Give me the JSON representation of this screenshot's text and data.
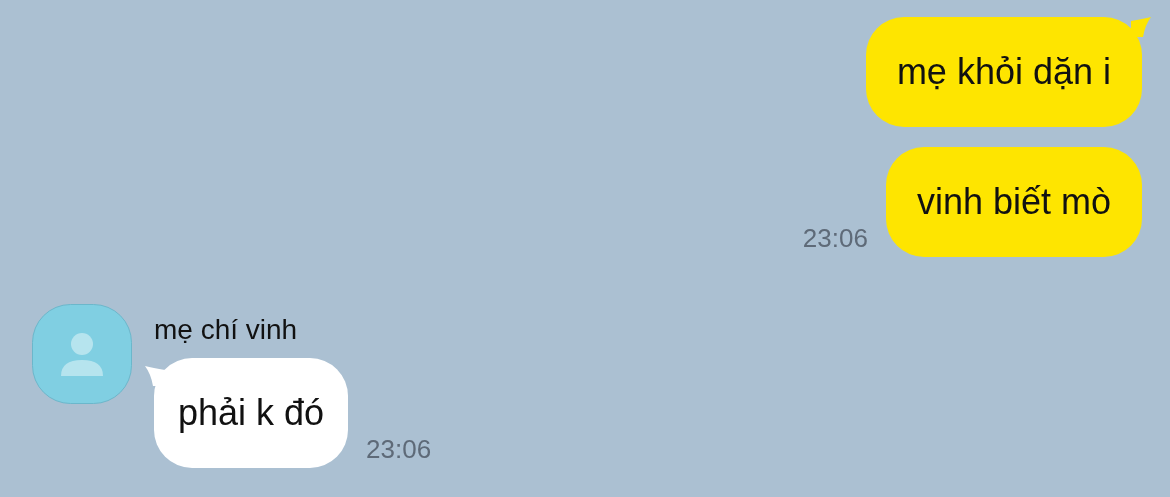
{
  "chat": {
    "groups": [
      {
        "kind": "outgoing",
        "messages": [
          {
            "text": "mẹ khỏi dặn i",
            "tail": true
          },
          {
            "text": "vinh biết mò",
            "tail": false
          }
        ],
        "time": "23:06"
      },
      {
        "kind": "incoming",
        "sender": "mẹ chí vinh",
        "messages": [
          {
            "text": "phải k đó",
            "tail": true
          }
        ],
        "time": "23:06"
      }
    ]
  }
}
